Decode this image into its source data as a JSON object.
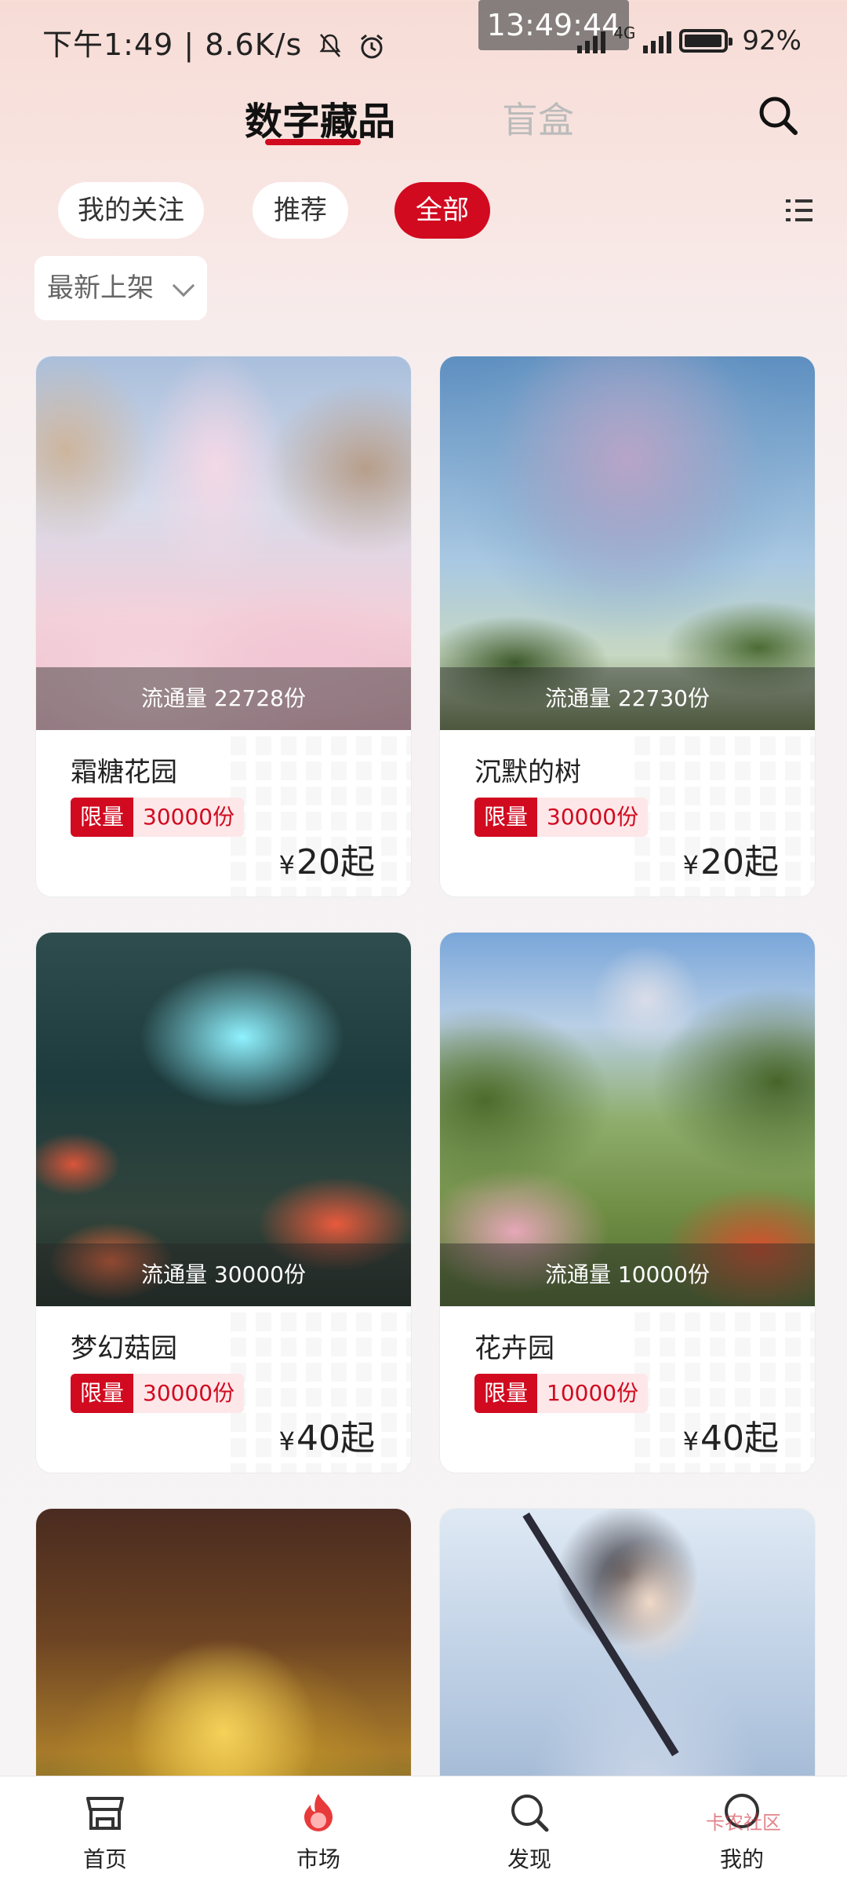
{
  "status_bar": {
    "left": "下午1:49 | 8.6K/s",
    "clock_overlay": "13:49:44",
    "network": "4G",
    "battery": "92%"
  },
  "header": {
    "tabs": [
      {
        "label": "数字藏品",
        "active": true
      },
      {
        "label": "盲盒",
        "active": false
      }
    ],
    "search_icon": "search-icon"
  },
  "filters": {
    "chips": [
      {
        "label": "我的关注",
        "active": false
      },
      {
        "label": "推荐",
        "active": false
      },
      {
        "label": "全部",
        "active": true
      }
    ],
    "view_toggle_icon": "list-view-icon",
    "sort_dropdown": "最新上架"
  },
  "products": [
    {
      "name": "霜糖花园",
      "circulation": "流通量 22728份",
      "limit_label": "限量",
      "limit_qty": "30000份",
      "price_symbol": "¥",
      "price": "20起"
    },
    {
      "name": "沉默的树",
      "circulation": "流通量 22730份",
      "limit_label": "限量",
      "limit_qty": "30000份",
      "price_symbol": "¥",
      "price": "20起"
    },
    {
      "name": "梦幻菇园",
      "circulation": "流通量 30000份",
      "limit_label": "限量",
      "limit_qty": "30000份",
      "price_symbol": "¥",
      "price": "40起"
    },
    {
      "name": "花卉园",
      "circulation": "流通量 10000份",
      "limit_label": "限量",
      "limit_qty": "10000份",
      "price_symbol": "¥",
      "price": "40起"
    }
  ],
  "bottom_nav": [
    {
      "label": "首页",
      "icon": "store-icon"
    },
    {
      "label": "市场",
      "icon": "flame-icon"
    },
    {
      "label": "发现",
      "icon": "discover-icon"
    },
    {
      "label": "我的",
      "icon": "profile-icon"
    }
  ],
  "watermark": "卡农社区",
  "colors": {
    "accent": "#d10a1f",
    "tab_inactive": "#bbbbbb"
  }
}
